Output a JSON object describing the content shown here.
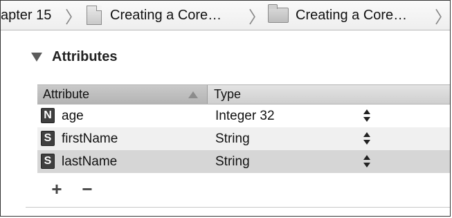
{
  "breadcrumb": [
    {
      "label": "apter 15",
      "icon": "none"
    },
    {
      "label": "Creating a Core…",
      "icon": "file-icon"
    },
    {
      "label": "Creating a Core…",
      "icon": "folder-icon"
    }
  ],
  "section": {
    "title": "Attributes"
  },
  "table": {
    "columns": {
      "attribute": "Attribute",
      "type": "Type"
    },
    "rows": [
      {
        "badge": "N",
        "name": "age",
        "type": "Integer 32",
        "selected": false
      },
      {
        "badge": "S",
        "name": "firstName",
        "type": "String",
        "selected": false
      },
      {
        "badge": "S",
        "name": "lastName",
        "type": "String",
        "selected": true
      }
    ]
  },
  "controls": {
    "add": "+",
    "remove": "−"
  }
}
